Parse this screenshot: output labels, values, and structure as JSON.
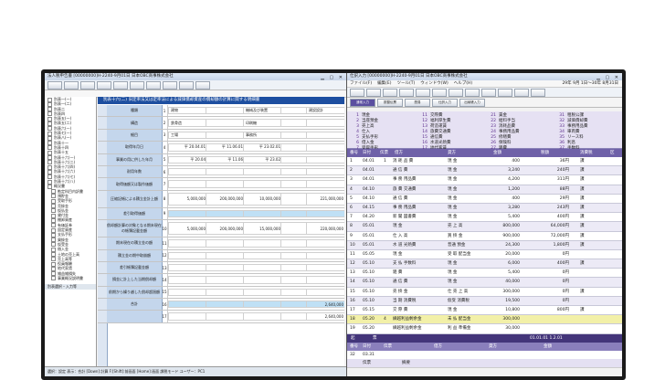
{
  "left_window": {
    "title": "法人税申告書 [00000000]H-2240-9月01日 日本OBC商事株式会社",
    "toolbar_buttons": [
      "",
      "",
      "",
      "",
      "",
      "",
      "",
      "",
      "",
      ""
    ],
    "tree_items": [
      "別表一(一)",
      "別表一(二)",
      "別表二",
      "別表四",
      "別表五(一)",
      "別表五(二)",
      "別表六(一)",
      "別表七(一)",
      "別表八(一)",
      "別表十一",
      "別表十四",
      "別表十五",
      "別表十六(一)",
      "別表十六(二)",
      "別表十六(四)",
      "別表十六(六)",
      "別表十六(七)",
      "別表十六(八)",
      "概況書",
      "勘定科目内訳書",
      "預貯金",
      "受取手形",
      "売掛金",
      "仮払金",
      "貸付金",
      "棚卸資産",
      "有価証券",
      "固定資産",
      "支払手形",
      "買掛金",
      "仮受金",
      "借入金",
      "土地の売上高",
      "売上高等",
      "役員報酬",
      "地代家賃",
      "雑益雑損失",
      "事業概況説明書"
    ],
    "tree_footer": "別表選択・入力等",
    "form_header": "別表十六(二) 旧定率法又は定率法による減価償却資産の償却額の計算に関する明細書",
    "rows": [
      {
        "label": "種類",
        "num": "1",
        "cells": [
          "建物",
          "",
          "機械及び装置",
          "",
          "建設設計"
        ]
      },
      {
        "label": "構造",
        "num": "2",
        "cells": [
          "鉄骨造",
          "",
          "印刷機",
          "",
          ""
        ]
      },
      {
        "label": "細目",
        "num": "3",
        "cells": [
          "工場",
          "",
          "事務所",
          "",
          ""
        ]
      },
      {
        "label": "取得年月日",
        "num": "4",
        "cells": [
          "平 20.04.01",
          "平 11.06.01",
          "平 23.02.01",
          "",
          ""
        ]
      },
      {
        "label": "事業の用に供した年月",
        "num": "5",
        "cells": [
          "平 20.04",
          "平 11.06",
          "平 23.02",
          "",
          ""
        ]
      },
      {
        "label": "耐用年数",
        "num": "6",
        "cells": [
          "",
          "",
          "",
          "",
          ""
        ]
      },
      {
        "label": "取得価額又は製作価額",
        "num": "7",
        "cells": [
          "",
          "",
          "",
          "",
          ""
        ]
      },
      {
        "label": "圧縮記帳による積立金計上額",
        "num": "8",
        "cells": [
          "5,000,000",
          "200,000,000",
          "10,000,000",
          "",
          "221,000,000"
        ]
      },
      {
        "label": "差引取得価額",
        "num": "9",
        "cells": [
          "",
          "",
          "",
          "",
          ""
        ]
      },
      {
        "label": "償却額計算の対象となる期末現在の帳簿記載金額",
        "num": "10",
        "cells": [
          "5,000,000",
          "200,000,000",
          "15,000,000",
          "",
          "220,000,000"
        ]
      },
      {
        "label": "期末現在の積立金の額",
        "num": "11",
        "cells": [
          "",
          "",
          "",
          "",
          ""
        ]
      },
      {
        "label": "積立金の期中取崩額",
        "num": "12",
        "cells": [
          "",
          "",
          "",
          "",
          ""
        ]
      },
      {
        "label": "差引帳簿記載金額",
        "num": "13",
        "cells": [
          "",
          "",
          "",
          "",
          ""
        ]
      },
      {
        "label": "損金に計上した当期償却額",
        "num": "14",
        "cells": [
          "",
          "",
          "",
          "",
          ""
        ]
      },
      {
        "label": "前期から繰り越した償却超過額",
        "num": "15",
        "cells": [
          "",
          "",
          "",
          "",
          ""
        ]
      },
      {
        "label": "合計",
        "num": "16",
        "cells": [
          "",
          "",
          "",
          "",
          "2,640,000"
        ]
      },
      {
        "label": "",
        "num": "17",
        "cells": [
          "",
          "",
          "",
          "",
          "2,640,000"
        ]
      }
    ],
    "status_text": "選択：設定   表示：合計   [Down]:計算 F:[Shift]:前画面   [Home]:画面   課税モード   ユーザー：PC1"
  },
  "right_window": {
    "title": "仕訳入力 [00000000]H-2240-9月01日 日本OBC商事株式会社",
    "title_date": "29年 9月 1日〜30年 8月31日",
    "menu": [
      "ファイル(F)",
      "編集(E)",
      "ツール(T)",
      "ウィンドウ(W)",
      "ヘルプ(H)"
    ],
    "toolbar_buttons": [
      "",
      "",
      "",
      "",
      "",
      "",
      "",
      "",
      "",
      "",
      "",
      ""
    ],
    "tabs": [
      "通常入力",
      "振替伝票",
      "簡易",
      "仕訳入力",
      "出納帳入力"
    ],
    "codes": [
      [
        "1 現金",
        "2 当座預金",
        "3 売上高",
        "4 仕入",
        "5 支払手形",
        "6 借入金",
        "7 受取手形",
        "8 売掛金"
      ],
      [
        "11 交際費",
        "12 福利厚生費",
        "13 荷造運賃",
        "14 旅費交通費",
        "15 通信費",
        "16 水道光熱費",
        "17 地代家賃",
        "18 支払手数料"
      ],
      [
        "21 賃金",
        "22 給料手当",
        "23 消耗品費",
        "24 事務用品費",
        "25 修繕費",
        "26 保険料",
        "27 雑費",
        "28 燃料費"
      ],
      [
        "31 租税公課",
        "32 減価償却費",
        "33 事務用品費",
        "34 車両費",
        "35 リース料",
        "36 利息",
        "37 手数料",
        "38 支払手数料"
      ]
    ],
    "journal_header": [
      "番号",
      "日付",
      "伝票",
      "借方",
      "貸方",
      "金額",
      "税額",
      "消費税",
      "区"
    ],
    "journal_rows": [
      [
        "1",
        "04.01",
        "1",
        "消 耗 品 費",
        "現 金",
        "400",
        "36円",
        "課"
      ],
      [
        "2",
        "04.01",
        "",
        "通 信 費",
        "現 金",
        "3,240",
        "240円",
        "課"
      ],
      [
        "3",
        "04.01",
        "",
        "事 務 用品費",
        "現 金",
        "4,200",
        "311円",
        "課"
      ],
      [
        "4",
        "04.10",
        "",
        "旅 費 交通費",
        "現 金",
        "1,200",
        "88円",
        "課"
      ],
      [
        "5",
        "04.10",
        "",
        "通 信 費",
        "現 金",
        "400",
        "29円",
        "課"
      ],
      [
        "6",
        "04.15",
        "",
        "事 務 用品費",
        "現 金",
        "3,280",
        "243円",
        "課"
      ],
      [
        "7",
        "04.20",
        "",
        "新 聞 図書費",
        "現 金",
        "5,400",
        "400円",
        "課"
      ],
      [
        "8",
        "05.01",
        "",
        "現 金",
        "売 上 高",
        "800,000",
        "64,000円",
        "課"
      ],
      [
        "9",
        "05.01",
        "",
        "仕 入 高",
        "買 掛 金",
        "900,000",
        "72,000円",
        "課"
      ],
      [
        "10",
        "05.01",
        "",
        "水 道 光熱費",
        "普通 預金",
        "24,300",
        "1,800円",
        "課"
      ],
      [
        "11",
        "05.05",
        "",
        "現 金",
        "受 取 配当金",
        "20,000",
        "0円",
        ""
      ],
      [
        "12",
        "05.10",
        "",
        "支 払 手数料",
        "現 金",
        "6,000",
        "400円",
        "課"
      ],
      [
        "13",
        "05.10",
        "",
        "雑 費",
        "現 金",
        "5,400",
        "0円",
        ""
      ],
      [
        "14",
        "05.10",
        "",
        "通 信 費",
        "現 金",
        "40,000",
        "0円",
        ""
      ],
      [
        "15",
        "05.10",
        "",
        "売 掛 金",
        "仕 売 上 高",
        "300,000",
        "0円",
        "課"
      ],
      [
        "16",
        "05.10",
        "",
        "当 期 消費税",
        "仮受 消費税",
        "19,500",
        "0円",
        ""
      ],
      [
        "17",
        "05.15",
        "",
        "交 際 費",
        "現 金",
        "10,800",
        "800円",
        "課"
      ],
      [
        "18",
        "05.20",
        "4",
        "繰越利益剰余金",
        "未 払 配当金",
        "300,000",
        "",
        ""
      ],
      [
        "19",
        "05.20",
        "",
        "繰越利益剰余金",
        "利 益 準備金",
        "30,000",
        "",
        ""
      ]
    ],
    "bottom_bar": [
      "起",
      "票",
      "01.01.01 1.2.01"
    ],
    "bottom_header": [
      "番号",
      "日付",
      "伝票",
      "借方",
      "貸方",
      "金額"
    ],
    "bottom_rows": [
      [
        "32",
        "03.31",
        ""
      ],
      [
        "",
        "伝票",
        "摘要"
      ]
    ]
  }
}
